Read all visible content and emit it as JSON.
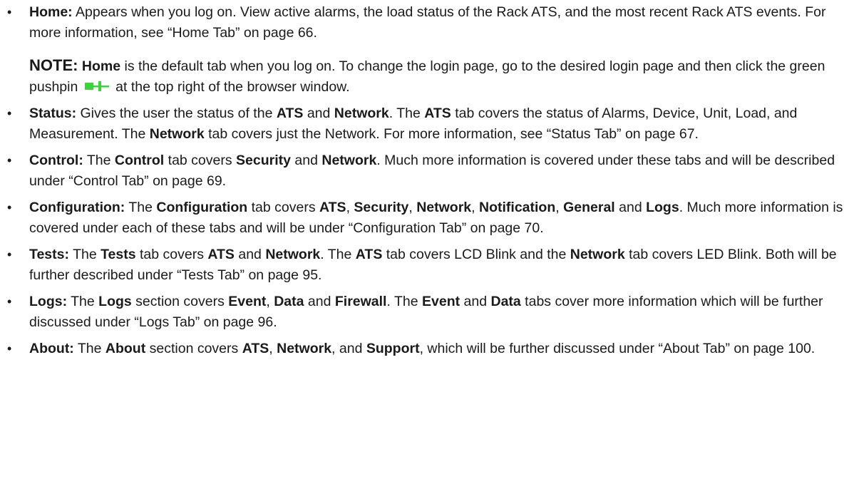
{
  "items": [
    {
      "label": "Home:",
      "text": "Appears when you log on. View active alarms, the load status of the Rack ATS, and the most recent Rack ATS events. For more information, see “Home Tab” on page 66."
    },
    {
      "label": "Status:",
      "t1": "Gives the user the status of the ",
      "b1": "ATS",
      "t2": " and ",
      "b2": "Network",
      "t3": ". The ",
      "b3": "ATS",
      "t4": " tab covers the status of Alarms, Device, Unit, Load, and Measurement. The ",
      "b4": "Network",
      "t5": " tab covers just the Network. For more information, see “Status Tab” on page 67."
    },
    {
      "label": "Control:",
      "t1": " The ",
      "b1": "Control",
      "t2": " tab covers ",
      "b2": "Security",
      "t3": " and ",
      "b3": "Network",
      "t4": ". Much more information is covered under these tabs and will be described under “Control Tab” on page 69."
    },
    {
      "label": "Configuration:",
      "t1": " The ",
      "b1": "Configuration",
      "t2": " tab covers ",
      "b2": "ATS",
      "t3": ", ",
      "b3": "Security",
      "t4": ", ",
      "b4": "Network",
      "t5": ", ",
      "b5": "Notification",
      "t6": ", ",
      "b6": "General",
      "t7": " and ",
      "b7": "Logs",
      "t8": ". Much more information is covered under each of these tabs and will be under “Configuration Tab” on page 70."
    },
    {
      "label": "Tests:",
      "t1": " The ",
      "b1": "Tests",
      "t2": " tab covers ",
      "b2": "ATS",
      "t3": " and ",
      "b3": "Network",
      "t4": ". The ",
      "b4": "ATS",
      "t5": " tab covers LCD Blink and the ",
      "b5": "Network",
      "t6": " tab covers LED Blink. Both will be further described under “Tests Tab” on page 95."
    },
    {
      "label": "Logs:",
      "t1": " The ",
      "b1": "Logs",
      "t2": " section covers ",
      "b2": "Event",
      "t3": ", ",
      "b3": "Data",
      "t4": " and ",
      "b4": "Firewall",
      "t5": ". The ",
      "b5": "Event",
      "t6": " and ",
      "b6": "Data",
      "t7": " tabs cover more information which will be further discussed under “Logs Tab” on page 96."
    },
    {
      "label": "About:",
      "t1": " The ",
      "b1": "About",
      "t2": " section covers ",
      "b2": "ATS",
      "t3": ", ",
      "b3": "Network",
      "t4": ", and ",
      "b4": "Support",
      "t5": ", which will be further discussed under “About Tab” on page 100."
    }
  ],
  "note": {
    "head": "NOTE:",
    "home": "Home",
    "t1": " is the default tab when you log on. To change the login page, go to the desired login page and then click the green pushpin",
    "t2": "at the top right of the browser window.",
    "pushpin_icon": "pushpin-icon",
    "pushpin_color": "#3cd23c"
  },
  "bullet": "•"
}
